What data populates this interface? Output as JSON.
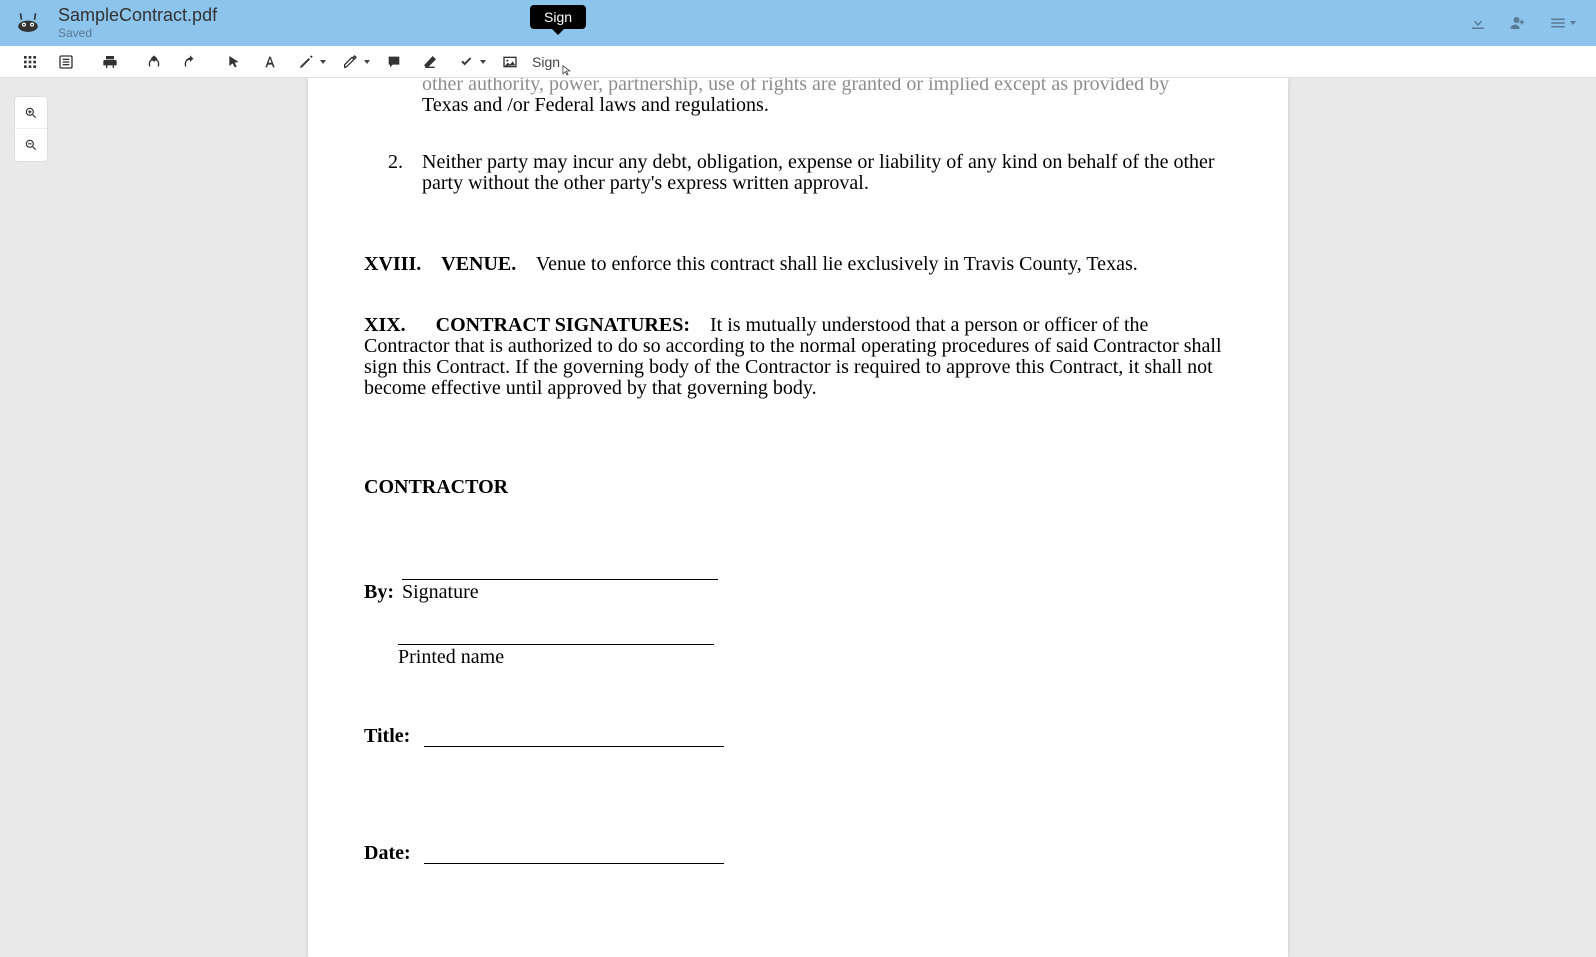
{
  "header": {
    "title": "SampleContract.pdf",
    "status": "Saved"
  },
  "tooltip": {
    "text": "Sign"
  },
  "toolbar": {
    "sign_label": "Sign"
  },
  "document": {
    "truncated_prev_line": "other authority, power, partnership, use of rights are granted or implied except as provided by",
    "item1_cont": "Texas and /or Federal laws and regulations.",
    "item2_num": "2.",
    "item2_text": "Neither party may incur any debt, obligation, expense or liability of any kind on behalf of the other party without the other party's express written approval.",
    "venue_num": "XVIII.",
    "venue_head": "VENUE.",
    "venue_text": "Venue to enforce this contract shall lie exclusively in Travis County, Texas.",
    "sig_num": "XIX.",
    "sig_head": "CONTRACT SIGNATURES:",
    "sig_text": "It is mutually understood that a person or officer of the Contractor that is authorized to do so according to the normal operating procedures of said Contractor shall sign this Contract.  If the governing body of the Contractor is required to approve this Contract, it shall not become effective until approved by that governing body.",
    "contractor_h": "CONTRACTOR",
    "by_label": "By:",
    "signature_under": "Signature",
    "printed_under": "Printed name",
    "title_label": "Title:",
    "date_label": "Date:"
  }
}
